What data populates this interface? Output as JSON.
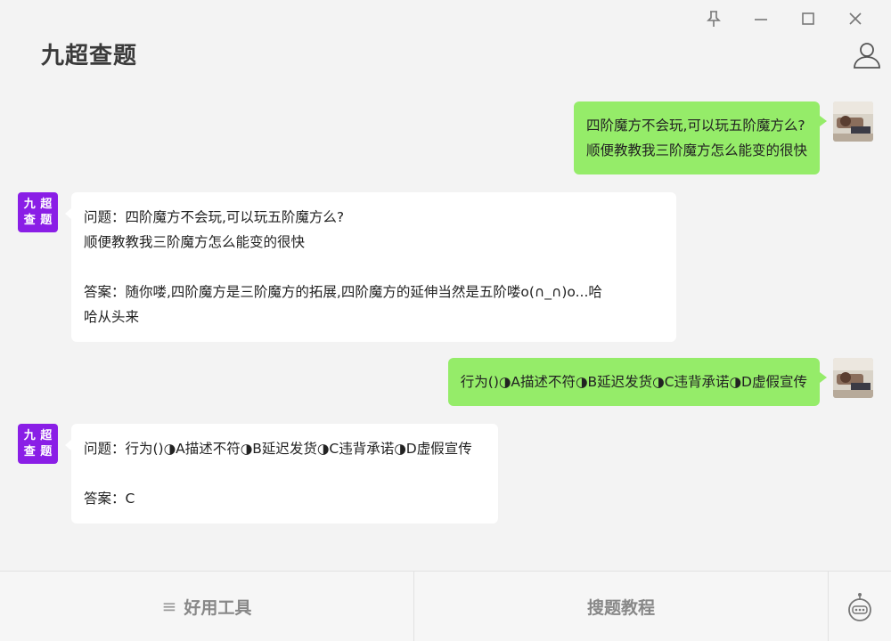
{
  "window": {
    "title": "九超查题",
    "controls": [
      "pin-icon",
      "minimize-icon",
      "maximize-icon",
      "close-icon"
    ]
  },
  "header": {
    "user_icon": "user-icon"
  },
  "bot": {
    "avatar_chars": [
      "九",
      "超",
      "查",
      "题"
    ]
  },
  "messages": [
    {
      "role": "user",
      "text": "四阶魔方不会玩,可以玩五阶魔方么?\n顺便教教我三阶魔方怎么能变的很快"
    },
    {
      "role": "bot",
      "text": "问题：四阶魔方不会玩,可以玩五阶魔方么?\n顺便教教我三阶魔方怎么能变的很快\n\n答案：随你喽,四阶魔方是三阶魔方的拓展,四阶魔方的延伸当然是五阶喽o(∩_∩)o...哈\n哈从头来"
    },
    {
      "role": "user",
      "text": "行为()◑A描述不符◑B延迟发货◑C违背承诺◑D虚假宣传"
    },
    {
      "role": "bot",
      "text": "问题：行为()◑A描述不符◑B延迟发货◑C违背承诺◑D虚假宣传\n\n答案：C"
    }
  ],
  "bottom": {
    "tab1_label": "好用工具",
    "tab2_label": "搜题教程",
    "tab3_icon": "robot-icon"
  },
  "colors": {
    "user_bubble": "#95ec69",
    "bot_avatar": "#8a1ee6"
  }
}
